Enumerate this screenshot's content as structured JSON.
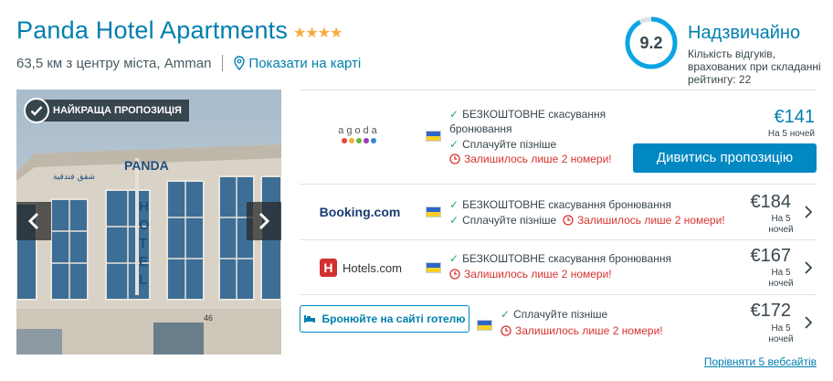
{
  "hotel": {
    "name": "Panda Hotel Apartments",
    "stars": "★★★★",
    "distance": "63,5 км з центру міста, Amman",
    "map_link": "Показати на карті"
  },
  "rating": {
    "score": "9.2",
    "label": "Надзвичайно",
    "count_text": "Кількість відгуків, врахованих при складанні рейтингу: 22",
    "score_fraction": 0.92
  },
  "photo": {
    "badge": "НАЙКРАЩА ПРОПОЗИЦІЯ",
    "sign_top": "PANDA",
    "sign_vertical": "HOTEL",
    "arabic_sign": "شقق فندقية",
    "door_number": "46"
  },
  "offers": [
    {
      "partner": "agoda",
      "feature_1": "БЕЗКОШТОВНЕ скасування бронювання",
      "feature_2": "Сплачуйте пізніше",
      "warning": "Залишилось лише 2 номери!",
      "price": "€141",
      "nights": "На 5 ночей",
      "button": "Дивитись пропозицію"
    },
    {
      "partner": "Booking.com",
      "feature_1": "БЕЗКОШТОВНЕ скасування бронювання",
      "feature_2": "Сплачуйте пізніше",
      "warning": "Залишилось лише 2 номери!",
      "price": "€184",
      "nights": "На 5 ночей"
    },
    {
      "partner": "Hotels.com",
      "feature_1": "БЕЗКОШТОВНЕ скасування бронювання",
      "feature_2": "Залишилось лише 2 номери!",
      "price": "€167",
      "nights": "На 5 ночей"
    },
    {
      "partner_button": "Бронюйте на сайті готелю",
      "feature_1": "Сплачуйте пізніше",
      "warning": "Залишилось лише 2 номери!",
      "price": "€172",
      "nights": "На 5 ночей"
    }
  ],
  "compare_link": "Порівняти 5 вебсайтів",
  "colors": {
    "brand_blue": "#007faf",
    "button_blue": "#0088c2",
    "warning_red": "#d6332f",
    "check_green": "#2fa85a",
    "star_gold": "#f6ab3f"
  },
  "icons": [
    "map-pin-icon",
    "check-icon",
    "clock-icon",
    "chevron-left-icon",
    "chevron-right-icon",
    "bed-icon",
    "ukraine-flag-icon"
  ]
}
